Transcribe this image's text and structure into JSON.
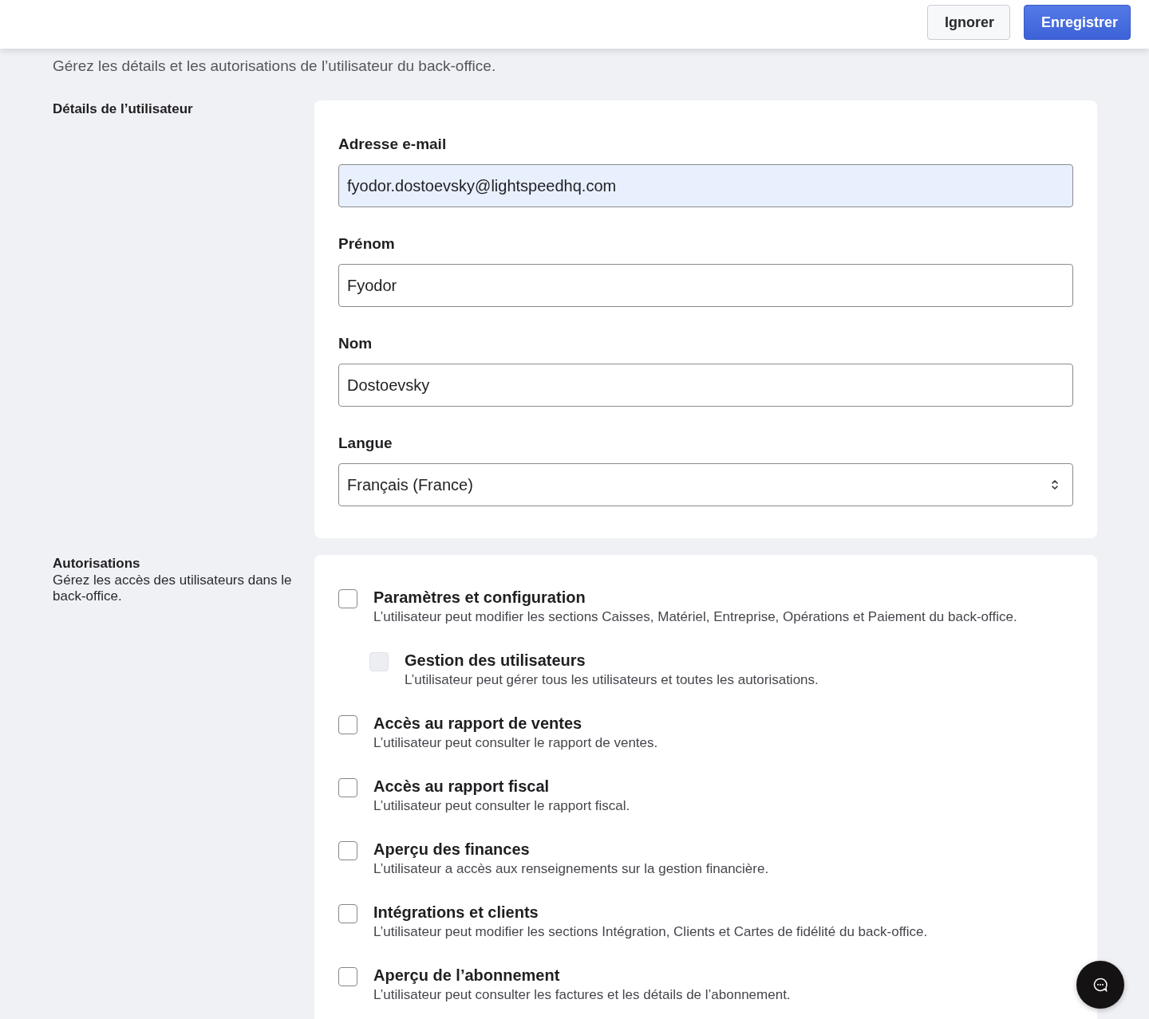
{
  "header": {
    "buttons": [
      {
        "label": "Ignorer",
        "kind": "secondary"
      },
      {
        "label": "Enregistrer",
        "kind": "primary"
      }
    ]
  },
  "intro": "Gérez les détails et les autorisations de l’utilisateur du back-office.",
  "user_details": {
    "title": "Détails de l’utilisateur",
    "fields": [
      {
        "label": "Adresse e-mail",
        "value": "fyodor.dostoevsky@lightspeedhq.com",
        "kind": "text",
        "autofilled": true
      },
      {
        "label": "Prénom",
        "value": "Fyodor",
        "kind": "text",
        "autofilled": false
      },
      {
        "label": "Nom",
        "value": "Dostoevsky",
        "kind": "text",
        "autofilled": false
      },
      {
        "label": "Langue",
        "value": "Français (France)",
        "kind": "select",
        "autofilled": false
      }
    ]
  },
  "permissions": {
    "title": "Autorisations",
    "description": "Gérez les accès des utilisateurs dans le back-office.",
    "items": [
      {
        "title": "Paramètres et configuration",
        "description": "L’utilisateur peut modifier les sections Caisses, Matériel, Entreprise, Opérations et Paiement du back-office.",
        "checked": false,
        "disabled": false,
        "children": [
          {
            "title": "Gestion des utilisateurs",
            "description": "L’utilisateur peut gérer tous les utilisateurs et toutes les autorisations.",
            "checked": false,
            "disabled": true
          }
        ]
      },
      {
        "title": "Accès au rapport de ventes",
        "description": "L’utilisateur peut consulter le rapport de ventes.",
        "checked": false,
        "disabled": false
      },
      {
        "title": "Accès au rapport fiscal",
        "description": "L’utilisateur peut consulter le rapport fiscal.",
        "checked": false,
        "disabled": false
      },
      {
        "title": "Aperçu des finances",
        "description": "L’utilisateur a accès aux renseignements sur la gestion financière.",
        "checked": false,
        "disabled": false
      },
      {
        "title": "Intégrations et clients",
        "description": "L’utilisateur peut modifier les sections Intégration, Clients et Cartes de fidélité du back-office.",
        "checked": false,
        "disabled": false
      },
      {
        "title": "Aperçu de l’abonnement",
        "description": "L’utilisateur peut consulter les factures et les détails de l’abonnement.",
        "checked": false,
        "disabled": false
      }
    ]
  }
}
